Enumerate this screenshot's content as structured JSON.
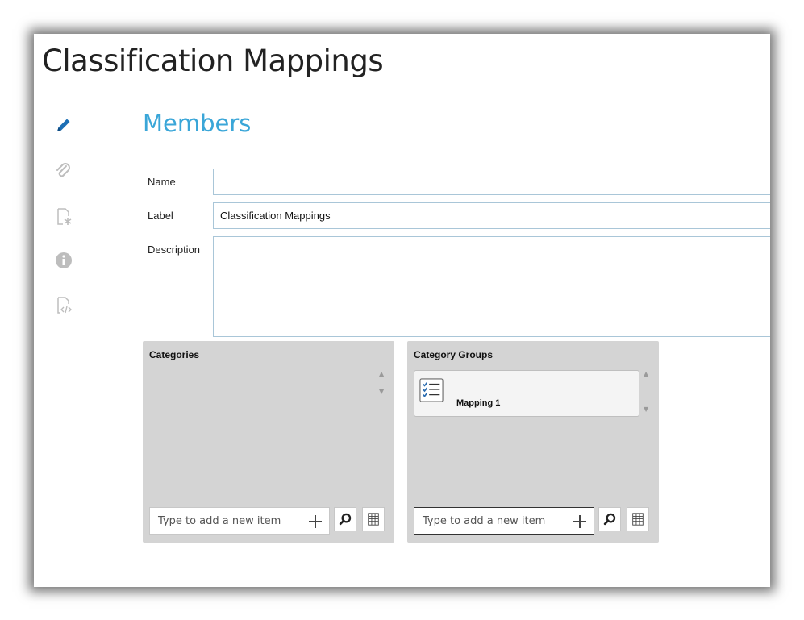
{
  "page": {
    "title": "Classification Mappings"
  },
  "sidebar": {
    "icons": [
      {
        "name": "pencil-icon",
        "color": "#1c6fb5"
      },
      {
        "name": "paperclip-icon",
        "color": "#bdbdbd"
      },
      {
        "name": "document-star-icon",
        "color": "#bdbdbd"
      },
      {
        "name": "info-icon",
        "color": "#bdbdbd"
      },
      {
        "name": "document-code-icon",
        "color": "#bdbdbd"
      }
    ]
  },
  "section": {
    "title": "Members",
    "accent": "#3aa6d8"
  },
  "form": {
    "name_label": "Name",
    "name_value": "",
    "label_label": "Label",
    "label_value": "Classification Mappings",
    "description_label": "Description",
    "description_value": ""
  },
  "categories": {
    "title": "Categories",
    "add_placeholder": "Type to add a new item"
  },
  "category_groups": {
    "title": "Category Groups",
    "items": [
      {
        "label": "Mapping 1",
        "icon": "checklist-icon"
      }
    ],
    "add_placeholder": "Type to add a new item"
  }
}
